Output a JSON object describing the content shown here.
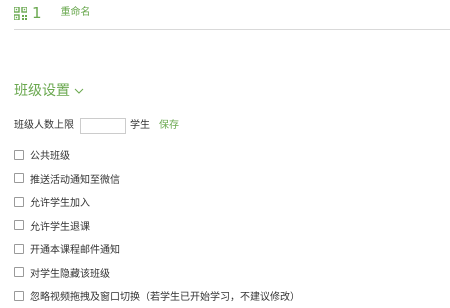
{
  "header": {
    "qr_icon": "qr-code-icon",
    "class_number": "1",
    "rename_label": "重命名"
  },
  "section": {
    "title": "班级设置",
    "toggle_icon": "chevron-down-icon"
  },
  "student_limit": {
    "label": "班级人数上限",
    "value": "",
    "unit": "学生",
    "save_label": "保存"
  },
  "options": [
    {
      "label": "公共班级",
      "checked": false
    },
    {
      "label": "推送活动通知至微信",
      "checked": false
    },
    {
      "label": "允许学生加入",
      "checked": false
    },
    {
      "label": "允许学生退课",
      "checked": false
    },
    {
      "label": "开通本课程邮件通知",
      "checked": false
    },
    {
      "label": "对学生隐藏该班级",
      "checked": false
    },
    {
      "label": "忽略视频拖拽及窗口切换（若学生已开始学习，不建议修改）",
      "checked": false
    }
  ],
  "colors": {
    "accent": "#6aa84f",
    "text": "#333333",
    "divider": "#d9d9d9",
    "checkbox_border": "#9a9a9a"
  }
}
